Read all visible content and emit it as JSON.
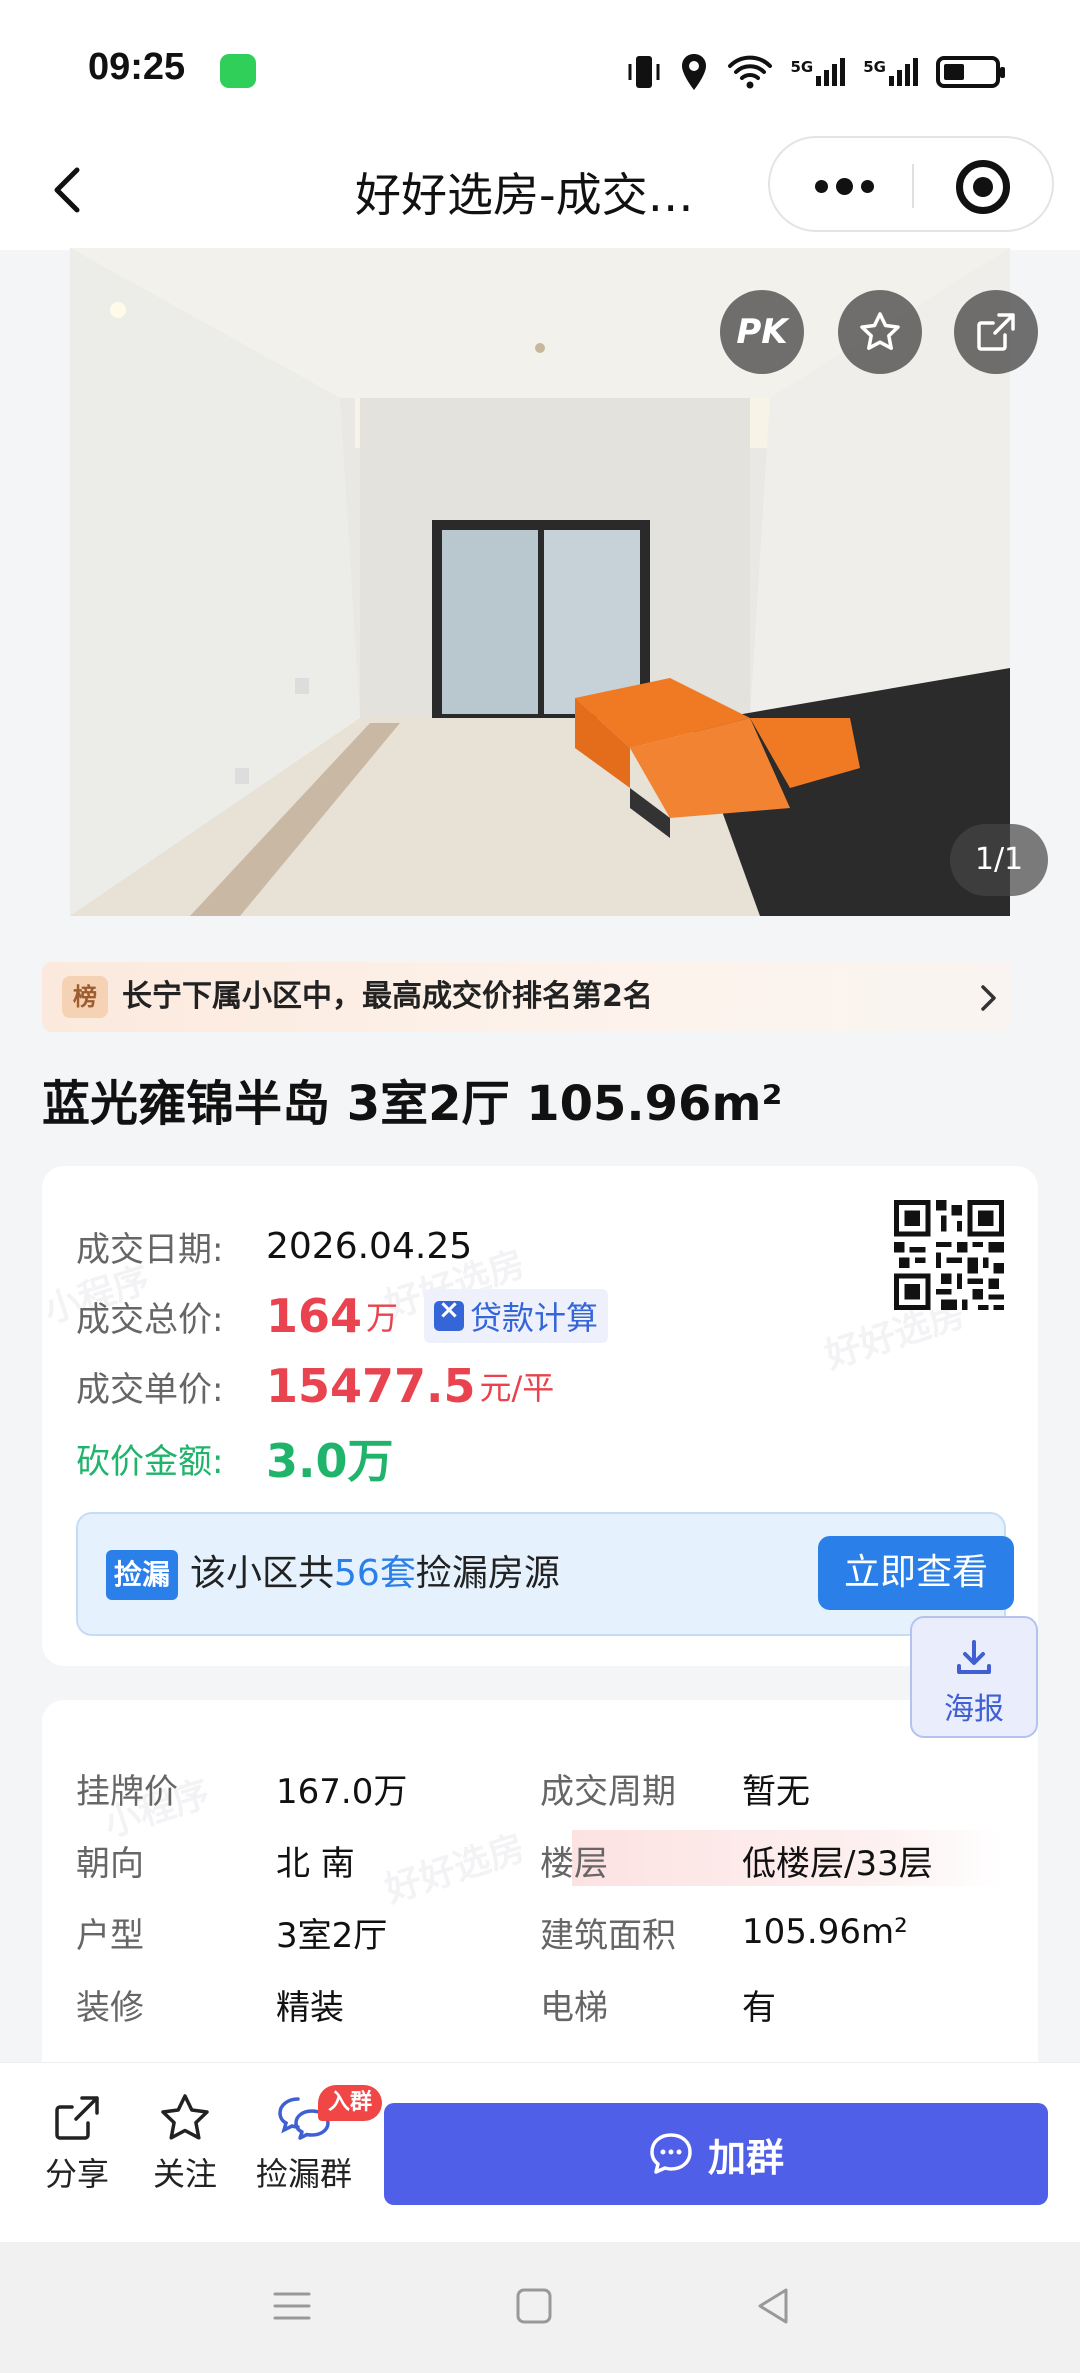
{
  "status_bar": {
    "time": "09:25",
    "network_1": "5G",
    "network_2": "5G"
  },
  "nav": {
    "title": "好好选房-成交…"
  },
  "photo": {
    "pk_label": "PK",
    "counter": "1/1"
  },
  "rank": {
    "badge": "榜",
    "text": "长宁下属小区中，最高成交价排名第2名"
  },
  "house_title": "蓝光雍锦半岛 3室2厅 105.96m²",
  "deal": {
    "date_label": "成交日期:",
    "date": "2026.04.25",
    "total_label": "成交总价:",
    "total": "164",
    "total_unit": "万",
    "loan_label": "贷款计算",
    "unit_price_label": "成交单价:",
    "unit_price": "15477.5",
    "unit_price_unit": "元/平",
    "bargain_label": "砍价金额:",
    "bargain": "3.0万"
  },
  "leak": {
    "badge": "捡漏",
    "text_before": "该小区共",
    "count": "56套",
    "text_after": "捡漏房源",
    "button": "立即查看"
  },
  "poster": {
    "label": "海报"
  },
  "details": [
    {
      "label": "挂牌价",
      "value": "167.0万",
      "label2": "成交周期",
      "value2": "暂无"
    },
    {
      "label": "朝向",
      "value": "北 南",
      "label2": "楼层",
      "value2": "低楼层/33层"
    },
    {
      "label": "户型",
      "value": "3室2厅",
      "label2": "建筑面积",
      "value2": "105.96m²"
    },
    {
      "label": "装修",
      "value": "精装",
      "label2": "电梯",
      "value2": "有"
    }
  ],
  "actions": {
    "share": "分享",
    "follow": "关注",
    "group": "捡漏群",
    "group_badge": "入群",
    "join": "加群"
  },
  "watermark": "好好选房",
  "watermark2": "小程序",
  "colors": {
    "price_red": "#e8434e",
    "bargain_green": "#20b36b",
    "accent_blue": "#2a7fe8",
    "join_button": "#4f5fe8"
  }
}
